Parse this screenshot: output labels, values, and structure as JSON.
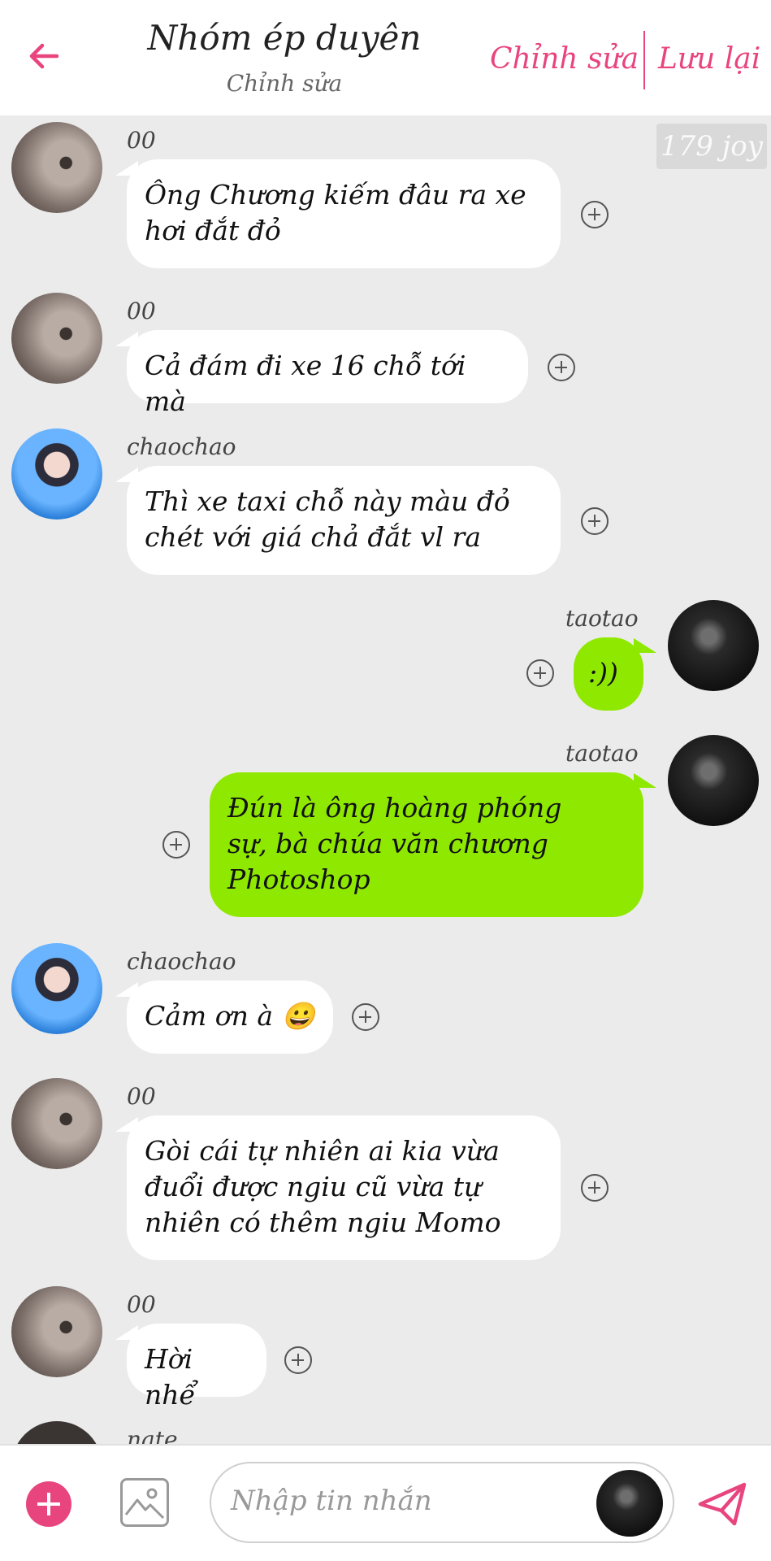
{
  "header": {
    "title": "Nhóm ép duyên",
    "subtitle": "Chỉnh sửa",
    "edit_label": "Chỉnh sửa",
    "save_label": "Lưu lại",
    "accent_color": "#e8457f"
  },
  "watermark": "179 joy",
  "messages": [
    {
      "sender": "00",
      "side": "left",
      "text1": "Ông Chương kiếm đâu ra xe",
      "text2": "hơi đắt đỏ"
    },
    {
      "sender": "00",
      "side": "left",
      "text1": "Cả đám đi xe 16 chỗ tới mà"
    },
    {
      "sender": "chaochao",
      "side": "left",
      "text1": "Thì xe taxi chỗ này màu đỏ",
      "text2": "chét với giá chả đắt vl ra"
    },
    {
      "sender": "taotao",
      "side": "right",
      "text1": ":))"
    },
    {
      "sender": "taotao",
      "side": "right",
      "text1": "Đún là ông hoàng phóng",
      "text2": "sự, bà chúa văn chương",
      "text3": "Photoshop"
    },
    {
      "sender": "chaochao",
      "side": "left",
      "text1": "Cảm ơn à 😀"
    },
    {
      "sender": "00",
      "side": "left",
      "text1": "Gòi cái tự nhiên ai kia vừa",
      "text2": "đuổi được ngiu cũ vừa tự",
      "text3": "nhiên có thêm ngiu Momo"
    },
    {
      "sender": "00",
      "side": "left",
      "text1": "Hời nhể"
    },
    {
      "sender": "nate",
      "side": "left"
    }
  ],
  "input": {
    "placeholder": "Nhập tin nhắn",
    "icons": [
      "plus-icon",
      "image-icon",
      "avatar",
      "send-icon"
    ]
  },
  "colors": {
    "incoming_bubble": "#ffffff",
    "outgoing_bubble": "#8fe800",
    "background": "#ebebeb"
  }
}
